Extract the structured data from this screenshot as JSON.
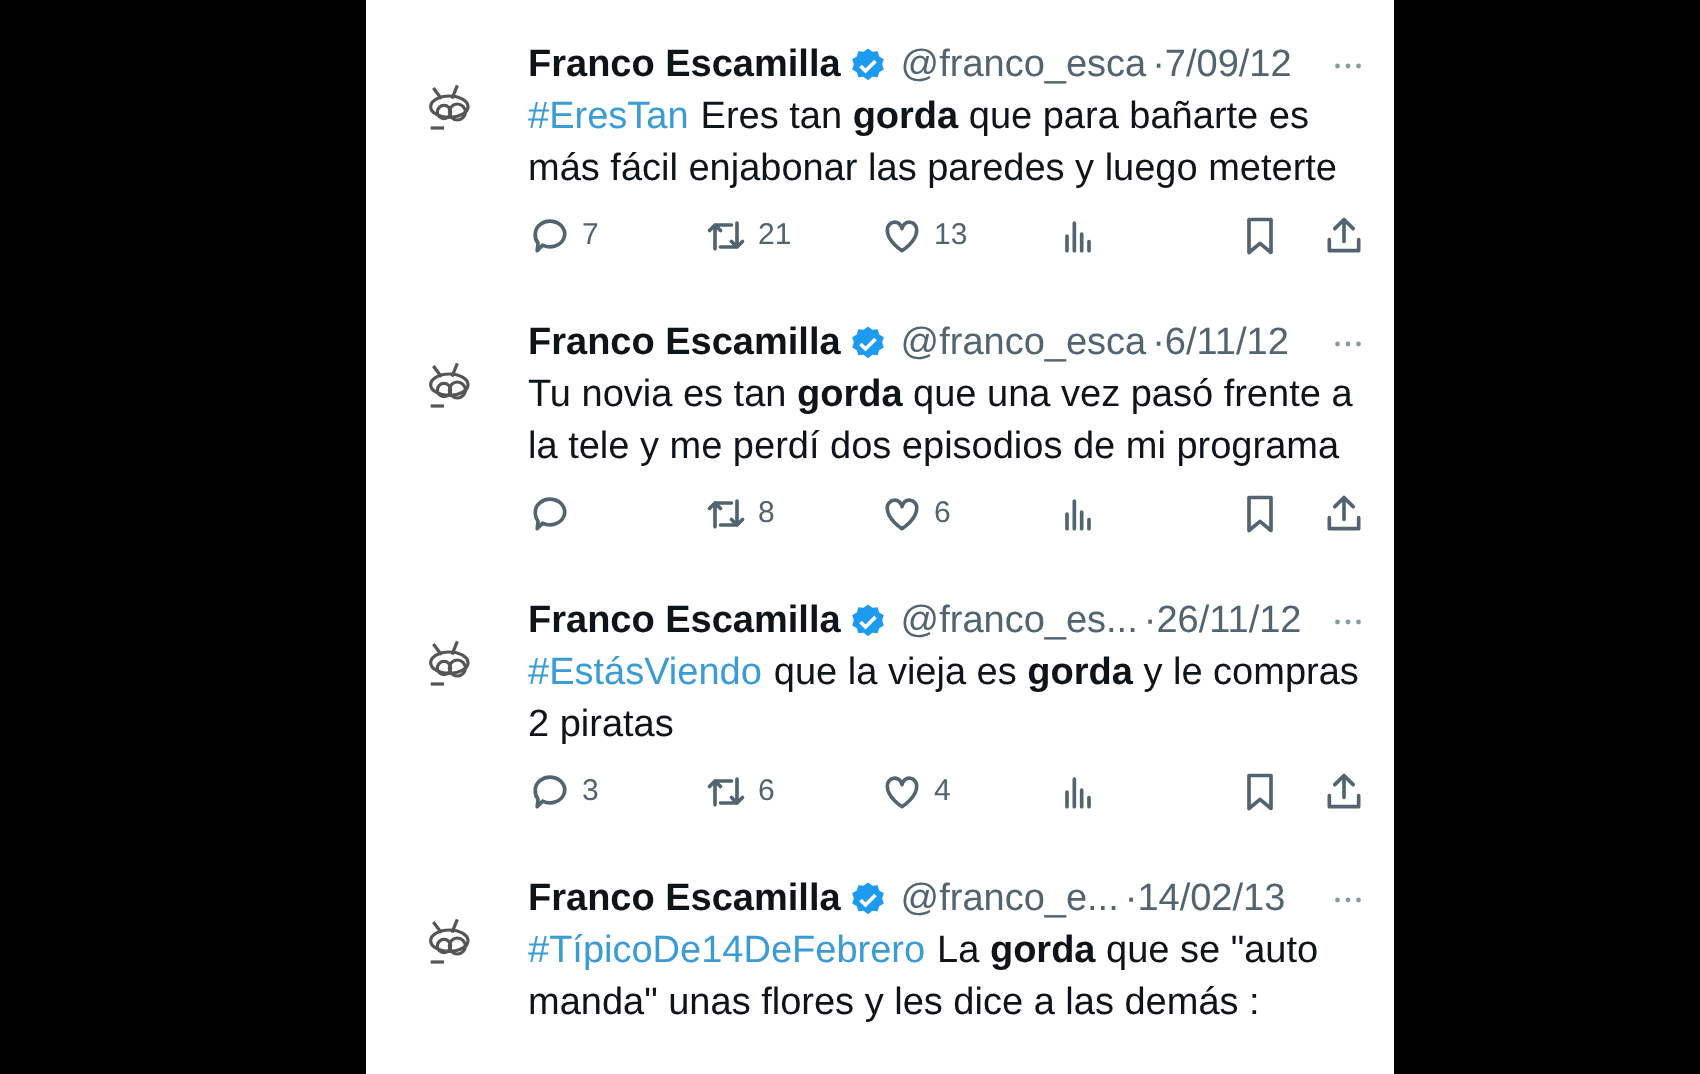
{
  "tweets": [
    {
      "name": "Franco Escamilla",
      "verified": true,
      "handle": "@franco_esca",
      "date": "·7/09/12",
      "hashtag": "#EresTan",
      "text": "Eres tan **gorda** que para bañarte es más fácil enjabonar las paredes y luego meterte",
      "actions": [
        {
          "kind": "reply",
          "count": "7"
        },
        {
          "kind": "retweet",
          "count": "21"
        },
        {
          "kind": "like",
          "count": "13"
        },
        {
          "kind": "views"
        },
        {
          "kind": "bookmark"
        },
        {
          "kind": "share"
        }
      ]
    },
    {
      "name": "Franco Escamilla",
      "verified": true,
      "handle": "@franco_esca",
      "date": "·6/11/12",
      "text": "Tu novia es tan **gorda** que una vez pasó frente a la tele y me perdí dos episodios de mi programa",
      "actions": [
        {
          "kind": "reply"
        },
        {
          "kind": "retweet",
          "count": "8"
        },
        {
          "kind": "like",
          "count": "6"
        },
        {
          "kind": "views"
        },
        {
          "kind": "bookmark"
        },
        {
          "kind": "share"
        }
      ]
    },
    {
      "name": "Franco Escamilla",
      "verified": true,
      "handle": "@franco_es...",
      "date": "·26/11/12",
      "hashtag": "#EstásViendo",
      "text": "que la vieja es **gorda** y le compras 2 piratas",
      "actions": [
        {
          "kind": "reply",
          "count": "3"
        },
        {
          "kind": "retweet",
          "count": "6"
        },
        {
          "kind": "like",
          "count": "4"
        },
        {
          "kind": "views"
        },
        {
          "kind": "bookmark"
        },
        {
          "kind": "share"
        }
      ]
    },
    {
      "name": "Franco Escamilla",
      "verified": true,
      "handle": "@franco_e...",
      "date": "·14/02/13",
      "hashtag": "#TípicoDe14DeFebrero",
      "text": "La **gorda** que se \"auto manda\" unas flores y les dice a las demás :"
    }
  ]
}
